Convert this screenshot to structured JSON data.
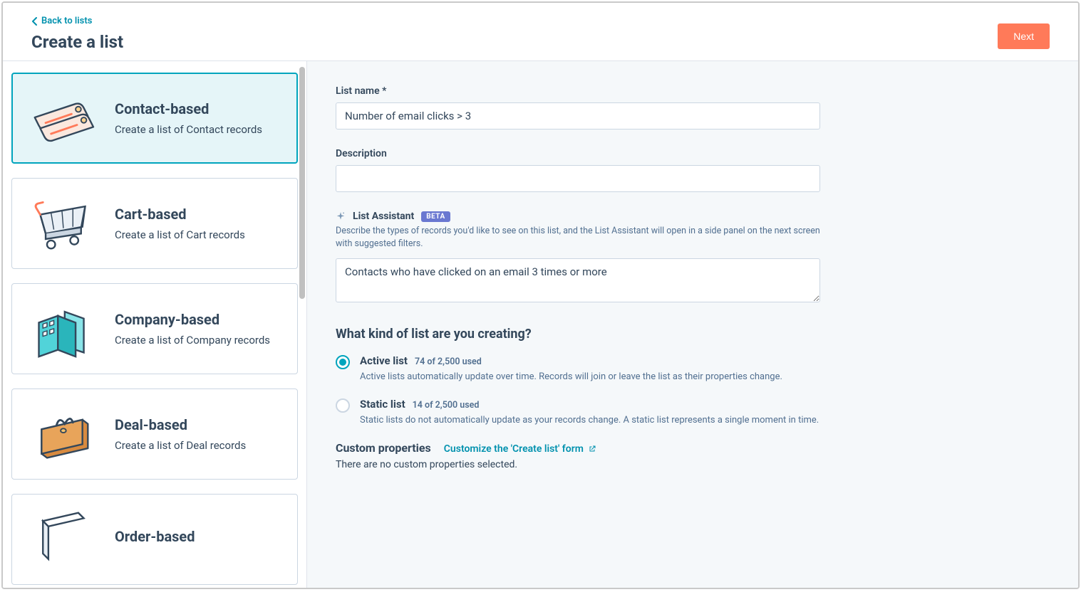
{
  "header": {
    "back_label": "Back to lists",
    "page_title": "Create a list",
    "next_label": "Next"
  },
  "cards": [
    {
      "title": "Contact-based",
      "desc": "Create a list of Contact records",
      "selected": true
    },
    {
      "title": "Cart-based",
      "desc": "Create a list of Cart records",
      "selected": false
    },
    {
      "title": "Company-based",
      "desc": "Create a list of Company records",
      "selected": false
    },
    {
      "title": "Deal-based",
      "desc": "Create a list of Deal records",
      "selected": false
    },
    {
      "title": "Order-based",
      "desc": "",
      "selected": false
    }
  ],
  "form": {
    "list_name_label": "List name *",
    "list_name_value": "Number of email clicks > 3",
    "description_label": "Description",
    "description_value": "",
    "assistant_title": "List Assistant",
    "assistant_badge": "BETA",
    "assistant_desc": "Describe the types of records you'd like to see on this list, and the List Assistant will open in a side panel on the next screen with suggested filters.",
    "assistant_value": "Contacts who have clicked on an email 3 times or more",
    "kind_heading": "What kind of list are you creating?",
    "radios": [
      {
        "label": "Active list",
        "count": "74 of 2,500 used",
        "desc": "Active lists automatically update over time. Records will join or leave the list as their properties change.",
        "checked": true
      },
      {
        "label": "Static list",
        "count": "14 of 2,500 used",
        "desc": "Static lists do not automatically update as your records change. A static list represents a single moment in time.",
        "checked": false
      }
    ],
    "custom_heading": "Custom properties",
    "custom_link": "Customize the 'Create list' form",
    "custom_note": "There are no custom properties selected."
  }
}
